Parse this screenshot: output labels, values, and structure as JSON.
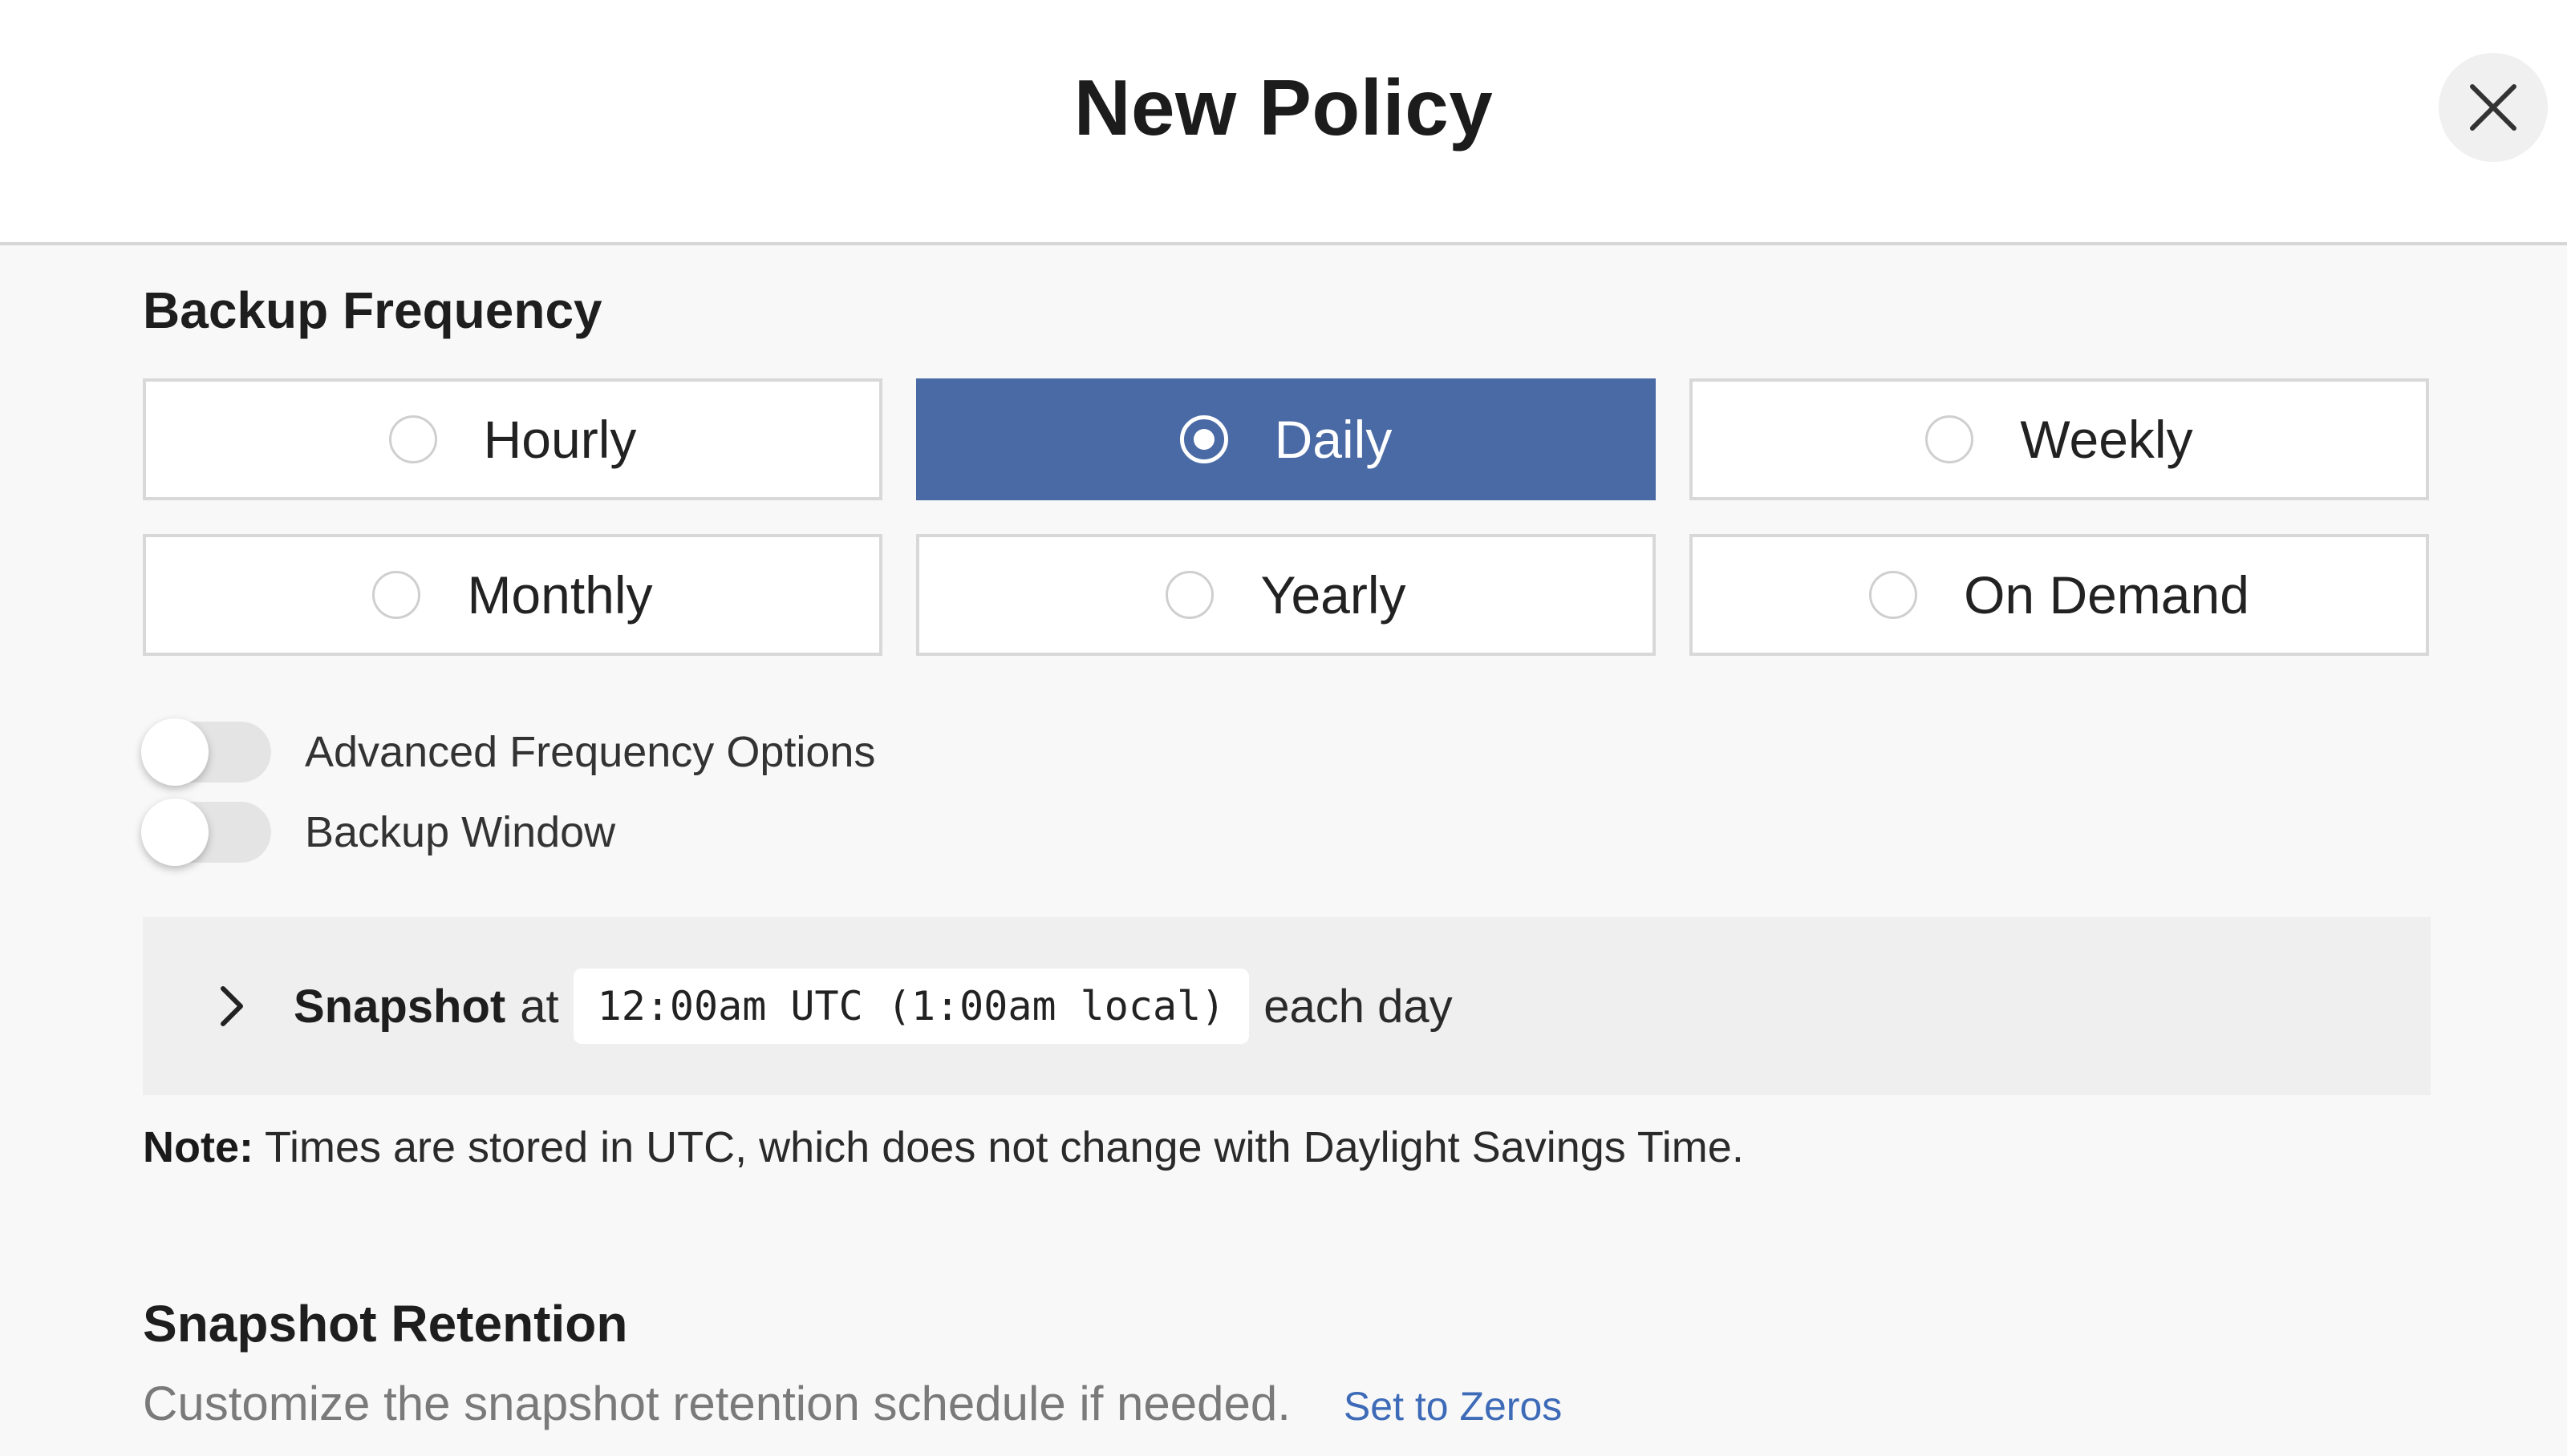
{
  "modal": {
    "title": "New Policy",
    "close_icon": "close-icon"
  },
  "backup_frequency": {
    "title": "Backup Frequency",
    "options": [
      {
        "label": "Hourly",
        "selected": false
      },
      {
        "label": "Daily",
        "selected": true
      },
      {
        "label": "Weekly",
        "selected": false
      },
      {
        "label": "Monthly",
        "selected": false
      },
      {
        "label": "Yearly",
        "selected": false
      },
      {
        "label": "On Demand",
        "selected": false
      }
    ],
    "selected_color": "#4a6aa5"
  },
  "toggles": {
    "advanced": {
      "label": "Advanced Frequency Options",
      "on": false
    },
    "window": {
      "label": "Backup Window",
      "on": false
    }
  },
  "snapshot": {
    "bold": "Snapshot",
    "at": "at",
    "time": "12:00am UTC (1:00am local)",
    "suffix": "each day",
    "chevron_icon": "chevron-right-icon"
  },
  "note": {
    "bold": "Note:",
    "text": " Times are stored in UTC, which does not change with Daylight Savings Time."
  },
  "retention": {
    "title": "Snapshot Retention",
    "description": "Customize the snapshot retention schedule if needed.",
    "link": "Set to Zeros",
    "link_color": "#3e6bb8"
  }
}
